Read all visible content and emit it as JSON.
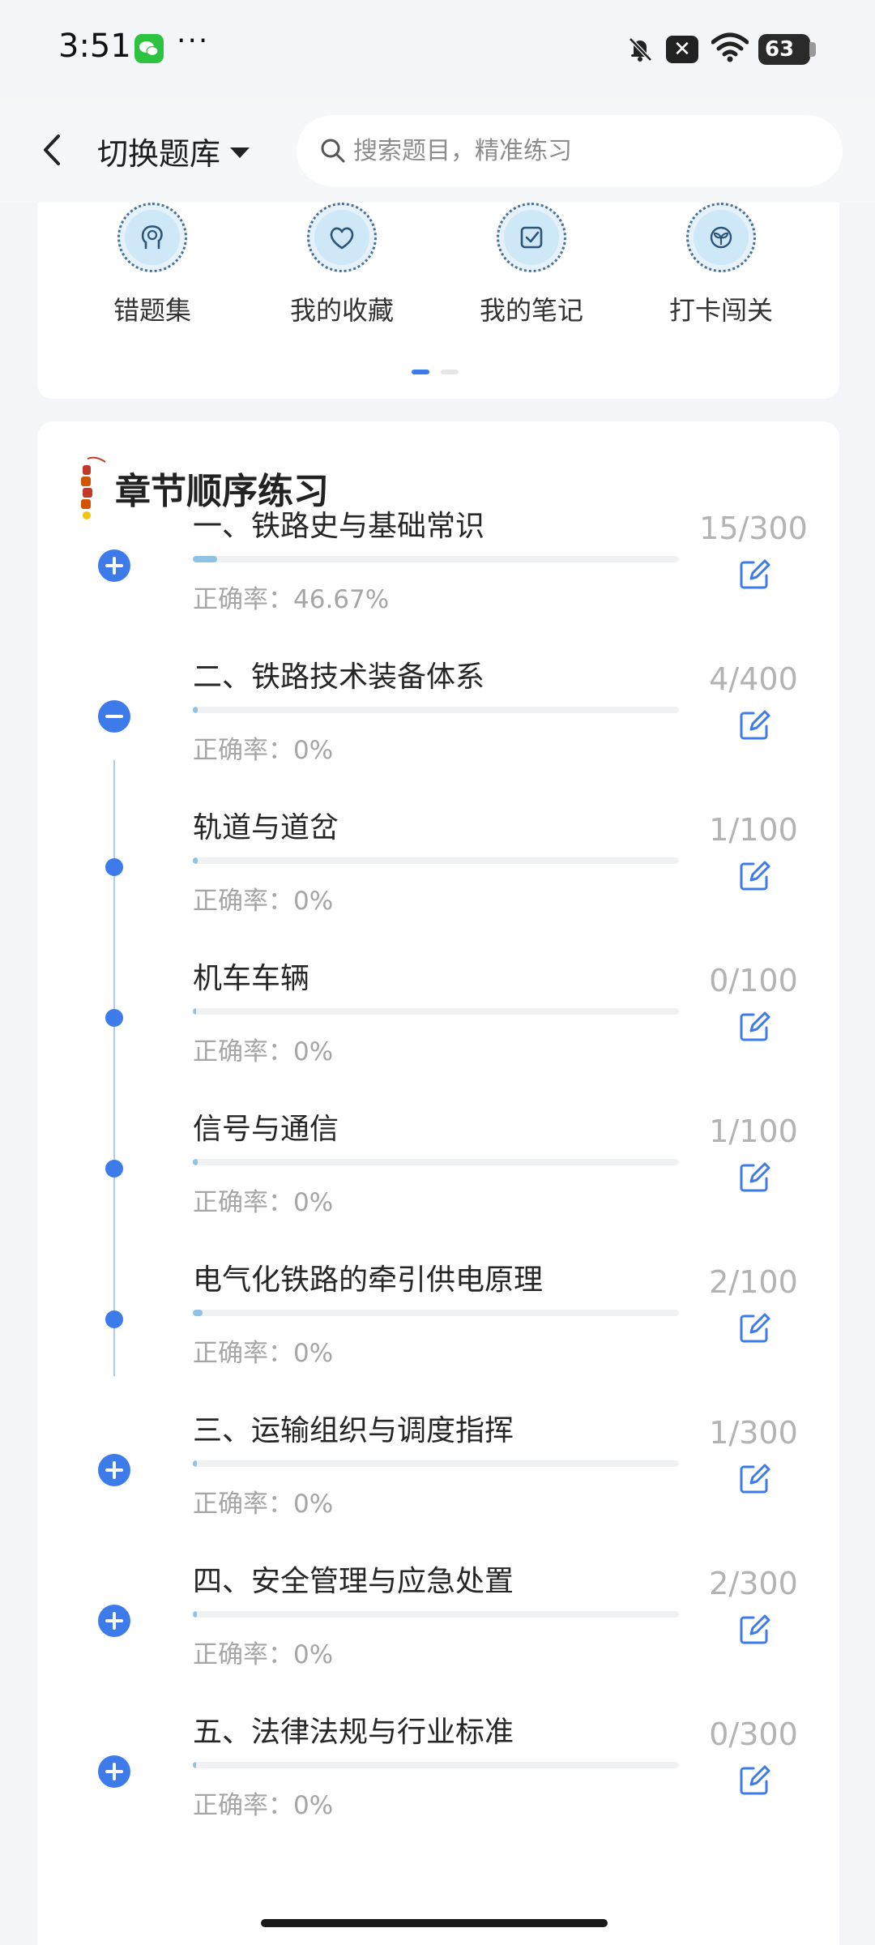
{
  "status_bar": {
    "time": "3:51",
    "more": "···",
    "battery": "63"
  },
  "header": {
    "switch_bank_label": "切换题库",
    "search_placeholder": "搜索题目，精准练习"
  },
  "shortcuts": [
    {
      "label": "错题集",
      "icon": "head-icon"
    },
    {
      "label": "我的收藏",
      "icon": "heart-icon"
    },
    {
      "label": "我的笔记",
      "icon": "note-check-icon"
    },
    {
      "label": "打卡闯关",
      "icon": "plant-icon"
    }
  ],
  "section": {
    "title": "章节顺序练习"
  },
  "colors": {
    "accent": "#3d7bea",
    "progress": "#8fc3e6",
    "muted_text": "#a6a6a6"
  },
  "chapters": [
    {
      "title": "一、铁路史与基础常识",
      "accuracy": "正确率：46.67%",
      "count": "15/300",
      "progress": 0.05,
      "node": "plus"
    },
    {
      "title": "二、铁路技术装备体系",
      "accuracy": "正确率：0%",
      "count": "4/400",
      "progress": 0.01,
      "node": "minus"
    },
    {
      "title": "轨道与道岔",
      "accuracy": "正确率：0%",
      "count": "1/100",
      "progress": 0.01,
      "node": "dot"
    },
    {
      "title": "机车车辆",
      "accuracy": "正确率：0%",
      "count": "0/100",
      "progress": 0,
      "node": "dot"
    },
    {
      "title": "信号与通信",
      "accuracy": "正确率：0%",
      "count": "1/100",
      "progress": 0.01,
      "node": "dot"
    },
    {
      "title": "电气化铁路的牵引供电原理",
      "accuracy": "正确率：0%",
      "count": "2/100",
      "progress": 0.02,
      "node": "dot"
    },
    {
      "title": "三、运输组织与调度指挥",
      "accuracy": "正确率：0%",
      "count": "1/300",
      "progress": 0.003,
      "node": "plus"
    },
    {
      "title": "四、安全管理与应急处置",
      "accuracy": "正确率：0%",
      "count": "2/300",
      "progress": 0.007,
      "node": "plus"
    },
    {
      "title": "五、法律法规与行业标准",
      "accuracy": "正确率：0%",
      "count": "0/300",
      "progress": 0,
      "node": "plus"
    }
  ]
}
